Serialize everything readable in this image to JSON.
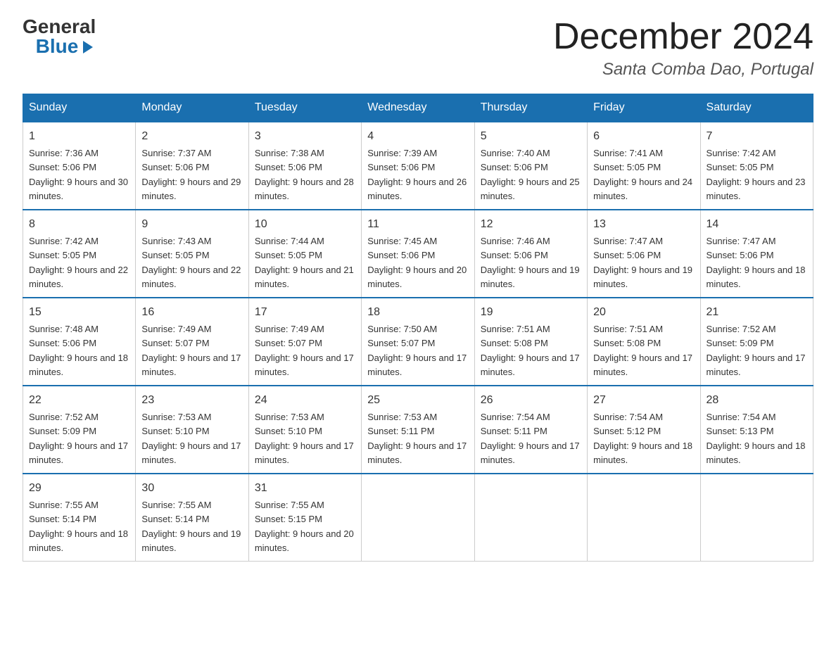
{
  "header": {
    "logo_general": "General",
    "logo_blue": "Blue",
    "month_title": "December 2024",
    "location": "Santa Comba Dao, Portugal"
  },
  "days_of_week": [
    "Sunday",
    "Monday",
    "Tuesday",
    "Wednesday",
    "Thursday",
    "Friday",
    "Saturday"
  ],
  "weeks": [
    [
      {
        "day": "1",
        "sunrise": "7:36 AM",
        "sunset": "5:06 PM",
        "daylight": "9 hours and 30 minutes."
      },
      {
        "day": "2",
        "sunrise": "7:37 AM",
        "sunset": "5:06 PM",
        "daylight": "9 hours and 29 minutes."
      },
      {
        "day": "3",
        "sunrise": "7:38 AM",
        "sunset": "5:06 PM",
        "daylight": "9 hours and 28 minutes."
      },
      {
        "day": "4",
        "sunrise": "7:39 AM",
        "sunset": "5:06 PM",
        "daylight": "9 hours and 26 minutes."
      },
      {
        "day": "5",
        "sunrise": "7:40 AM",
        "sunset": "5:06 PM",
        "daylight": "9 hours and 25 minutes."
      },
      {
        "day": "6",
        "sunrise": "7:41 AM",
        "sunset": "5:05 PM",
        "daylight": "9 hours and 24 minutes."
      },
      {
        "day": "7",
        "sunrise": "7:42 AM",
        "sunset": "5:05 PM",
        "daylight": "9 hours and 23 minutes."
      }
    ],
    [
      {
        "day": "8",
        "sunrise": "7:42 AM",
        "sunset": "5:05 PM",
        "daylight": "9 hours and 22 minutes."
      },
      {
        "day": "9",
        "sunrise": "7:43 AM",
        "sunset": "5:05 PM",
        "daylight": "9 hours and 22 minutes."
      },
      {
        "day": "10",
        "sunrise": "7:44 AM",
        "sunset": "5:05 PM",
        "daylight": "9 hours and 21 minutes."
      },
      {
        "day": "11",
        "sunrise": "7:45 AM",
        "sunset": "5:06 PM",
        "daylight": "9 hours and 20 minutes."
      },
      {
        "day": "12",
        "sunrise": "7:46 AM",
        "sunset": "5:06 PM",
        "daylight": "9 hours and 19 minutes."
      },
      {
        "day": "13",
        "sunrise": "7:47 AM",
        "sunset": "5:06 PM",
        "daylight": "9 hours and 19 minutes."
      },
      {
        "day": "14",
        "sunrise": "7:47 AM",
        "sunset": "5:06 PM",
        "daylight": "9 hours and 18 minutes."
      }
    ],
    [
      {
        "day": "15",
        "sunrise": "7:48 AM",
        "sunset": "5:06 PM",
        "daylight": "9 hours and 18 minutes."
      },
      {
        "day": "16",
        "sunrise": "7:49 AM",
        "sunset": "5:07 PM",
        "daylight": "9 hours and 17 minutes."
      },
      {
        "day": "17",
        "sunrise": "7:49 AM",
        "sunset": "5:07 PM",
        "daylight": "9 hours and 17 minutes."
      },
      {
        "day": "18",
        "sunrise": "7:50 AM",
        "sunset": "5:07 PM",
        "daylight": "9 hours and 17 minutes."
      },
      {
        "day": "19",
        "sunrise": "7:51 AM",
        "sunset": "5:08 PM",
        "daylight": "9 hours and 17 minutes."
      },
      {
        "day": "20",
        "sunrise": "7:51 AM",
        "sunset": "5:08 PM",
        "daylight": "9 hours and 17 minutes."
      },
      {
        "day": "21",
        "sunrise": "7:52 AM",
        "sunset": "5:09 PM",
        "daylight": "9 hours and 17 minutes."
      }
    ],
    [
      {
        "day": "22",
        "sunrise": "7:52 AM",
        "sunset": "5:09 PM",
        "daylight": "9 hours and 17 minutes."
      },
      {
        "day": "23",
        "sunrise": "7:53 AM",
        "sunset": "5:10 PM",
        "daylight": "9 hours and 17 minutes."
      },
      {
        "day": "24",
        "sunrise": "7:53 AM",
        "sunset": "5:10 PM",
        "daylight": "9 hours and 17 minutes."
      },
      {
        "day": "25",
        "sunrise": "7:53 AM",
        "sunset": "5:11 PM",
        "daylight": "9 hours and 17 minutes."
      },
      {
        "day": "26",
        "sunrise": "7:54 AM",
        "sunset": "5:11 PM",
        "daylight": "9 hours and 17 minutes."
      },
      {
        "day": "27",
        "sunrise": "7:54 AM",
        "sunset": "5:12 PM",
        "daylight": "9 hours and 18 minutes."
      },
      {
        "day": "28",
        "sunrise": "7:54 AM",
        "sunset": "5:13 PM",
        "daylight": "9 hours and 18 minutes."
      }
    ],
    [
      {
        "day": "29",
        "sunrise": "7:55 AM",
        "sunset": "5:14 PM",
        "daylight": "9 hours and 18 minutes."
      },
      {
        "day": "30",
        "sunrise": "7:55 AM",
        "sunset": "5:14 PM",
        "daylight": "9 hours and 19 minutes."
      },
      {
        "day": "31",
        "sunrise": "7:55 AM",
        "sunset": "5:15 PM",
        "daylight": "9 hours and 20 minutes."
      },
      null,
      null,
      null,
      null
    ]
  ]
}
